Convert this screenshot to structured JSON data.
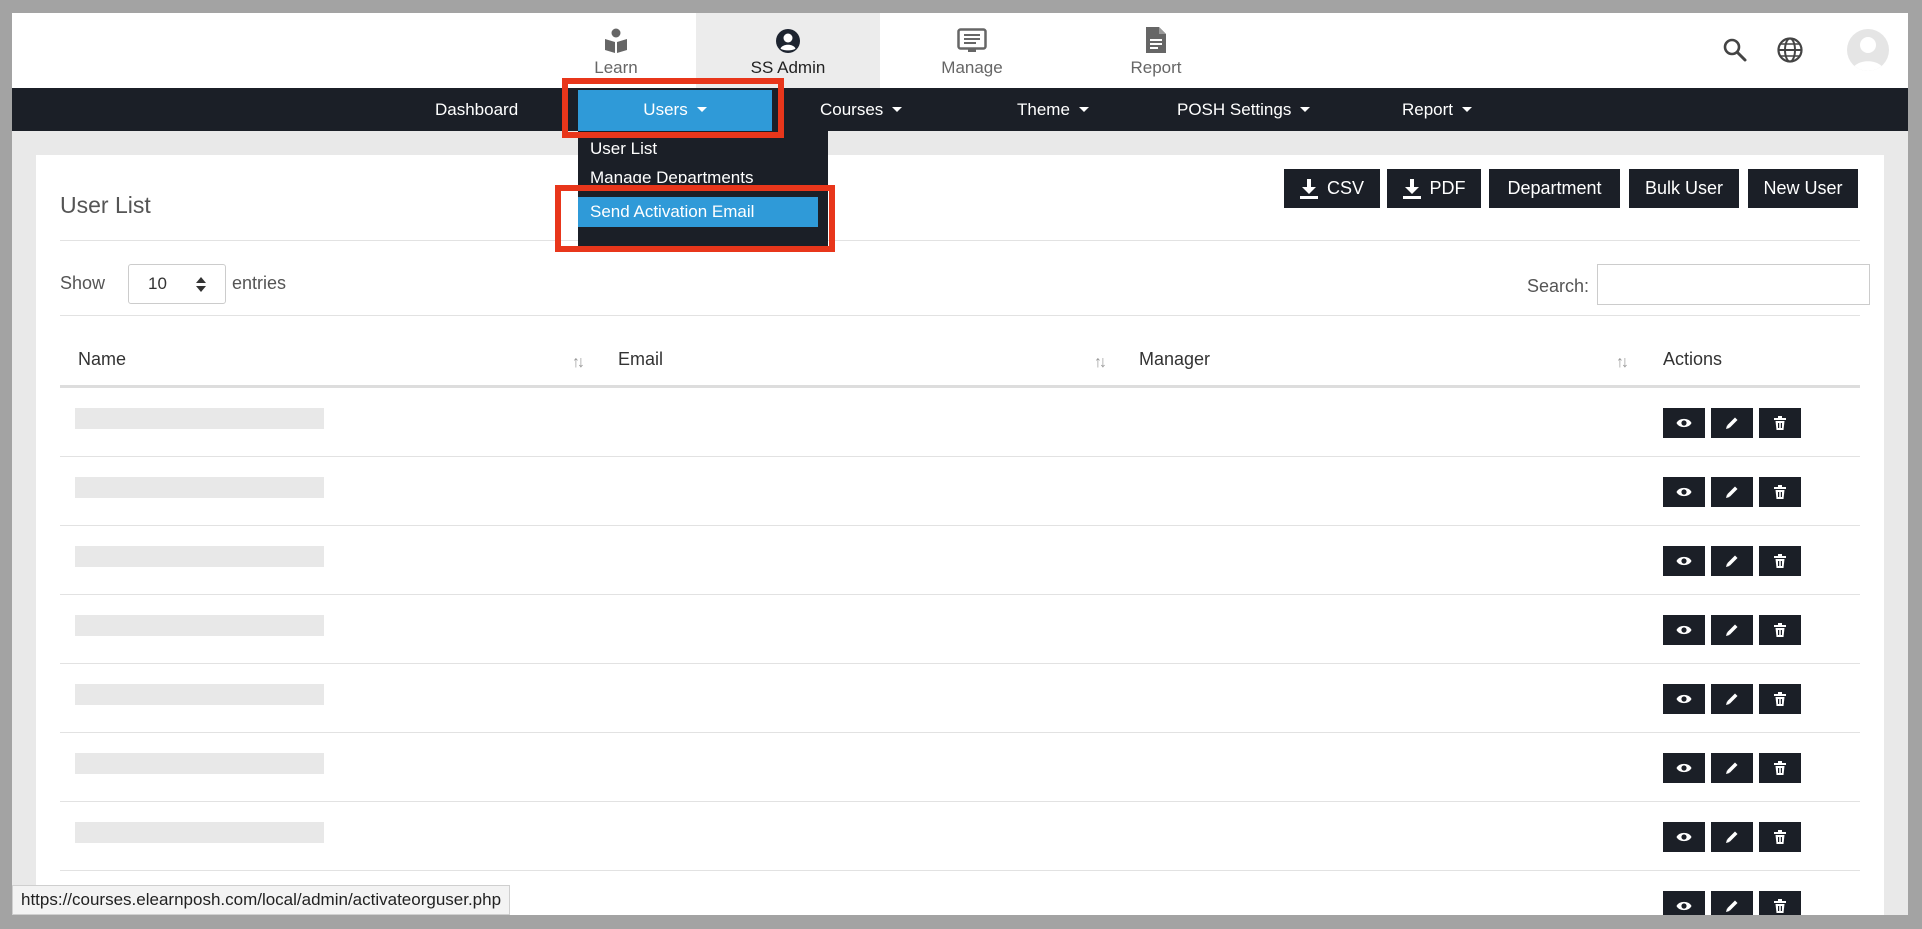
{
  "top_tabs": [
    {
      "label": "Learn",
      "icon": "book-reader-icon"
    },
    {
      "label": "SS Admin",
      "icon": "user-circle-icon"
    },
    {
      "label": "Manage",
      "icon": "monitor-list-icon"
    },
    {
      "label": "Report",
      "icon": "document-icon"
    }
  ],
  "header_icons": [
    "search-icon",
    "globe-icon",
    "avatar-icon"
  ],
  "nav": {
    "dashboard": "Dashboard",
    "users": "Users",
    "courses": "Courses",
    "theme": "Theme",
    "posh_settings": "POSH Settings",
    "report": "Report"
  },
  "users_dropdown": {
    "user_list": "User List",
    "manage_departments": "Manage Departments",
    "send_activation_email": "Send Activation Email"
  },
  "card": {
    "title": "User List",
    "buttons": {
      "csv": "CSV",
      "pdf": "PDF",
      "department": "Department",
      "bulk_user": "Bulk User",
      "new_user": "New User"
    },
    "show_label": "Show",
    "entries_value": "10",
    "entries_label": "entries",
    "search_label": "Search:",
    "columns": {
      "name": "Name",
      "email": "Email",
      "manager": "Manager",
      "actions": "Actions"
    },
    "row_count": 8,
    "row_actions": [
      "eye-icon",
      "pencil-icon",
      "trash-icon"
    ]
  },
  "status_url": "https://courses.elearnposh.com/local/admin/activateorguser.php",
  "colors": {
    "dark_nav": "#1b1f27",
    "accent_blue": "#2f9ad8",
    "highlight_red": "#e8361b"
  }
}
